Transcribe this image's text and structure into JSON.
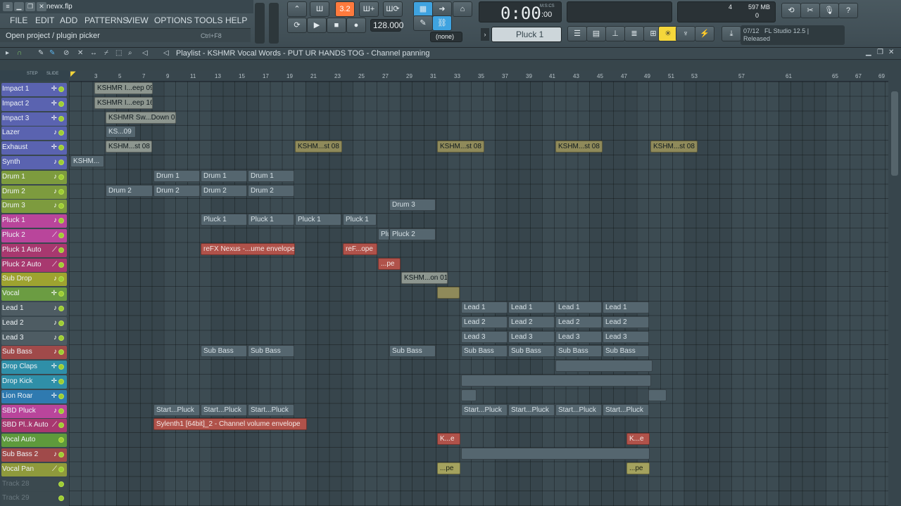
{
  "window": {
    "title": "newx.flp",
    "min": "▁",
    "max": "❐",
    "close": "✕"
  },
  "menu": [
    "FILE",
    "EDIT",
    "ADD",
    "PATTERNS",
    "VIEW",
    "OPTIONS",
    "TOOLS",
    "HELP"
  ],
  "hint": {
    "text": "Open project / plugin picker",
    "shortcut": "Ctrl+F8"
  },
  "transport": {
    "time": "0:00",
    "time_small": ":00",
    "time_unit": "M:S:CS",
    "tempo": "128.000",
    "pattern": "(none)",
    "pattern_mode": "3.2",
    "channel": "Pluck 1"
  },
  "system": {
    "cpu": "4",
    "mem": "597 MB",
    "voices": "0"
  },
  "news": {
    "date": "07/12",
    "product": "FL Studio 12.5 |",
    "status": "Released"
  },
  "playlist": {
    "title": "Playlist - KSHMR Vocal Words - PUT UR HANDS TOG - Channel panning",
    "step": "STEP",
    "slide": "SLIDE"
  },
  "ruler": [
    "3",
    "5",
    "7",
    "9",
    "11",
    "13",
    "15",
    "17",
    "19",
    "21",
    "23",
    "25",
    "27",
    "29",
    "31",
    "33",
    "35",
    "37",
    "39",
    "41",
    "43",
    "45",
    "47",
    "49",
    "51",
    "53",
    "57",
    "61",
    "65",
    "67",
    "69"
  ],
  "colors": {
    "accent": "#ff7a3d",
    "selected_tool": "#f5d73b",
    "grid": "#3c4b52"
  },
  "tracks": [
    {
      "name": "Impact 1",
      "color": "#5a63b0",
      "icon": "✛"
    },
    {
      "name": "Impact 2",
      "color": "#5a63b0",
      "icon": "✛"
    },
    {
      "name": "Impact 3",
      "color": "#5a63b0",
      "icon": "✛"
    },
    {
      "name": "Lazer",
      "color": "#5a63b0",
      "icon": "♪"
    },
    {
      "name": "Exhaust",
      "color": "#5a63b0",
      "icon": "✛"
    },
    {
      "name": "Synth",
      "color": "#5a63b0",
      "icon": "♪"
    },
    {
      "name": "Drum 1",
      "color": "#7d9b3e",
      "icon": "♪"
    },
    {
      "name": "Drum 2",
      "color": "#7d9b3e",
      "icon": "♪"
    },
    {
      "name": "Drum 3",
      "color": "#7d9b3e",
      "icon": "♪"
    },
    {
      "name": "Pluck 1",
      "color": "#b9459b",
      "icon": "♪"
    },
    {
      "name": "Pluck 2",
      "color": "#b9459b",
      "icon": "⟋"
    },
    {
      "name": "Pluck 1 Auto",
      "color": "#a8386f",
      "icon": "⟋"
    },
    {
      "name": "Pluck 2 Auto",
      "color": "#a8386f",
      "icon": "⟋"
    },
    {
      "name": "Sub Drop",
      "color": "#9ea330",
      "icon": "♪"
    },
    {
      "name": "Vocal",
      "color": "#6b9c42",
      "icon": "✛"
    },
    {
      "name": "Lead 1",
      "color": "#4e5c63",
      "icon": "♪"
    },
    {
      "name": "Lead 2",
      "color": "#4e5c63",
      "icon": "♪"
    },
    {
      "name": "Lead 3",
      "color": "#4e5c63",
      "icon": "♪"
    },
    {
      "name": "Sub Bass",
      "color": "#a04a4a",
      "icon": "♪"
    },
    {
      "name": "Drop Claps",
      "color": "#2f8fa8",
      "icon": "✛"
    },
    {
      "name": "Drop Kick",
      "color": "#2f8fa8",
      "icon": "✛"
    },
    {
      "name": "Lion Roar",
      "color": "#2f7ab0",
      "icon": "✛"
    },
    {
      "name": "SBD Pluck",
      "color": "#b9459b",
      "icon": "♪"
    },
    {
      "name": "SBD Pl..k Auto",
      "color": "#a8386f",
      "icon": "⟋"
    },
    {
      "name": "Vocal Auto",
      "color": "#5e9a3c",
      "icon": ""
    },
    {
      "name": "Sub Bass 2",
      "color": "#a04a4a",
      "icon": "♪"
    },
    {
      "name": "Vocal Pan",
      "color": "#8f9a3c",
      "icon": "⟋"
    },
    {
      "name": "Track 28",
      "color": "#3b494f",
      "icon": ""
    },
    {
      "name": "Track 29",
      "color": "#3b494f",
      "icon": ""
    }
  ],
  "clips": {
    "imp1": "KSHMR I...eep 09",
    "imp2": "KSHMR I...eep 16",
    "imp3": "KSHMR Sw...Down 09",
    "laz": "KS...09",
    "exh": "KSHM...st 08",
    "syn": "KSHM...",
    "d1": "Drum 1",
    "d2": "Drum 2",
    "d3": "Drum 3",
    "p1": "Pluck 1",
    "p2": "Pluck 2",
    "p1a": "reFX Nexus -...ume envelope",
    "p1a2": "reF...ope",
    "p2a": "...pe",
    "sd": "KSHM...on 01",
    "l1": "Lead 1",
    "l2": "Lead 2",
    "l3": "Lead 3",
    "sb": "Sub Bass",
    "sbd": "Start...Pluck",
    "sbda": "Sylenth1 [64bit]_2 - Channel volume envelope",
    "va": "K...e",
    "vp": "...pe"
  }
}
